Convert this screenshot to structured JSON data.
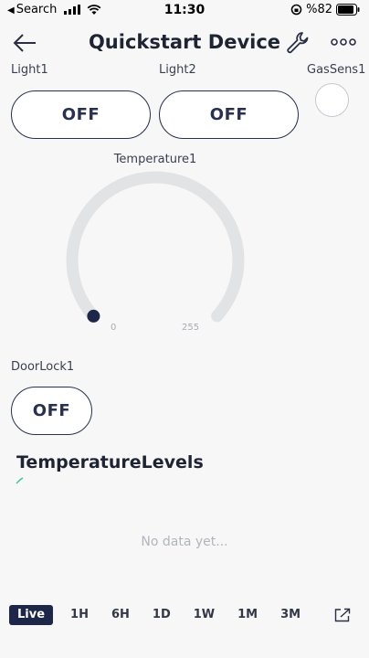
{
  "status_bar": {
    "back_app": "Search",
    "time": "11:30",
    "battery": "%82"
  },
  "header": {
    "title": "Quickstart Device"
  },
  "widgets": {
    "light1": {
      "label": "Light1",
      "state": "OFF"
    },
    "light2": {
      "label": "Light2",
      "state": "OFF"
    },
    "gas_sensor": {
      "label": "GasSens1"
    },
    "temperature_gauge": {
      "label": "Temperature1",
      "min": "0",
      "max": "255",
      "value": 0
    },
    "door_lock": {
      "label": "DoorLock1",
      "state": "OFF"
    }
  },
  "chart": {
    "title": "TemperatureLevels",
    "empty_text": "No data yet...",
    "ranges": [
      "Live",
      "1H",
      "6H",
      "1D",
      "1W",
      "1M",
      "3M"
    ],
    "active_range": "Live"
  },
  "colors": {
    "primary": "#2a3050",
    "track": "#e1e3e5",
    "active_tab": "#1f2748",
    "chart_accent": "#3ec7a0"
  }
}
